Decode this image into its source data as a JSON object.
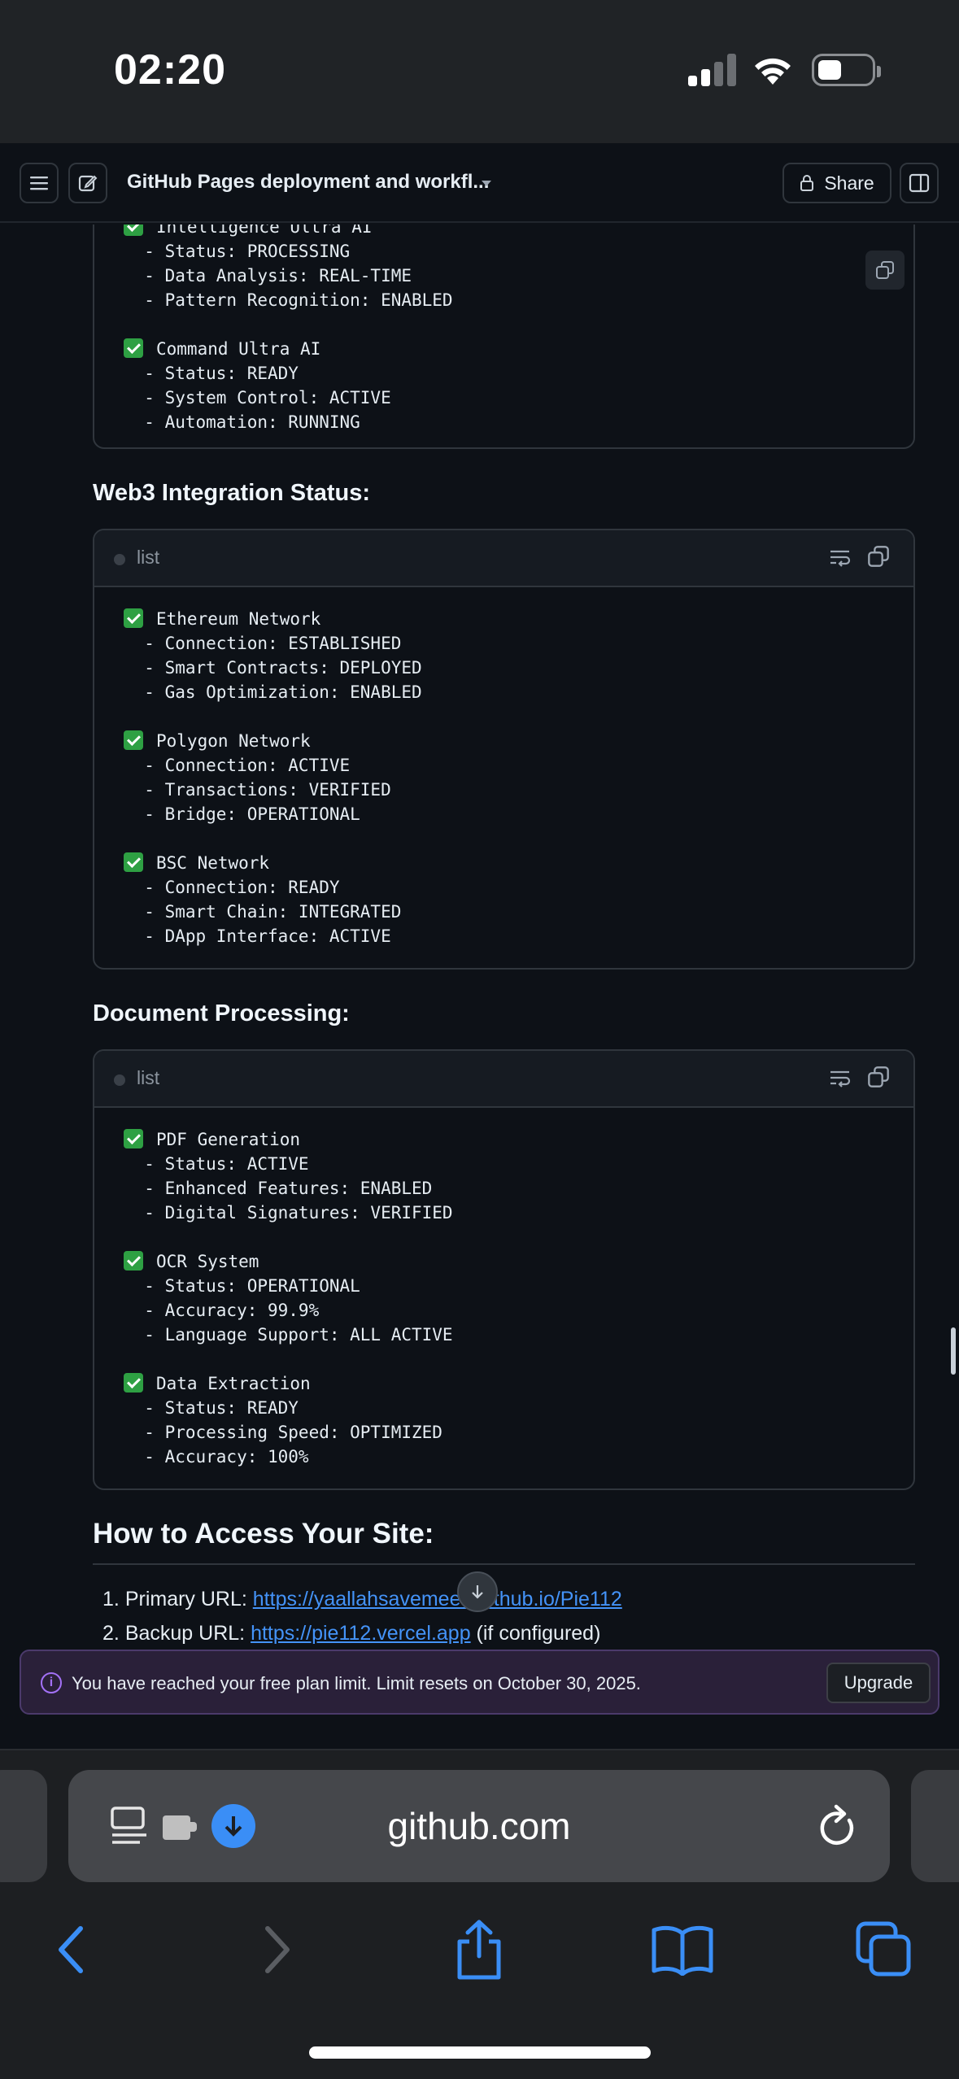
{
  "status_bar": {
    "time": "02:20"
  },
  "header": {
    "title": "GitHub Pages deployment and workfl...",
    "share_label": "Share"
  },
  "blocks": [
    {
      "lang": "",
      "lines": [
        {
          "check": true,
          "text": "Intelligence Ultra AI"
        },
        {
          "check": false,
          "text": "  - Status: PROCESSING"
        },
        {
          "check": false,
          "text": "  - Data Analysis: REAL-TIME"
        },
        {
          "check": false,
          "text": "  - Pattern Recognition: ENABLED"
        },
        {
          "check": false,
          "text": ""
        },
        {
          "check": true,
          "text": "Command Ultra AI"
        },
        {
          "check": false,
          "text": "  - Status: READY"
        },
        {
          "check": false,
          "text": "  - System Control: ACTIVE"
        },
        {
          "check": false,
          "text": "  - Automation: RUNNING"
        }
      ]
    },
    {
      "heading": "Web3 Integration Status:",
      "lang": "list",
      "lines": [
        {
          "check": true,
          "text": "Ethereum Network"
        },
        {
          "check": false,
          "text": "  - Connection: ESTABLISHED"
        },
        {
          "check": false,
          "text": "  - Smart Contracts: DEPLOYED"
        },
        {
          "check": false,
          "text": "  - Gas Optimization: ENABLED"
        },
        {
          "check": false,
          "text": ""
        },
        {
          "check": true,
          "text": "Polygon Network"
        },
        {
          "check": false,
          "text": "  - Connection: ACTIVE"
        },
        {
          "check": false,
          "text": "  - Transactions: VERIFIED"
        },
        {
          "check": false,
          "text": "  - Bridge: OPERATIONAL"
        },
        {
          "check": false,
          "text": ""
        },
        {
          "check": true,
          "text": "BSC Network"
        },
        {
          "check": false,
          "text": "  - Connection: READY"
        },
        {
          "check": false,
          "text": "  - Smart Chain: INTEGRATED"
        },
        {
          "check": false,
          "text": "  - DApp Interface: ACTIVE"
        }
      ]
    },
    {
      "heading": "Document Processing:",
      "lang": "list",
      "lines": [
        {
          "check": true,
          "text": "PDF Generation"
        },
        {
          "check": false,
          "text": "  - Status: ACTIVE"
        },
        {
          "check": false,
          "text": "  - Enhanced Features: ENABLED"
        },
        {
          "check": false,
          "text": "  - Digital Signatures: VERIFIED"
        },
        {
          "check": false,
          "text": ""
        },
        {
          "check": true,
          "text": "OCR System"
        },
        {
          "check": false,
          "text": "  - Status: OPERATIONAL"
        },
        {
          "check": false,
          "text": "  - Accuracy: 99.9%"
        },
        {
          "check": false,
          "text": "  - Language Support: ALL ACTIVE"
        },
        {
          "check": false,
          "text": ""
        },
        {
          "check": true,
          "text": "Data Extraction"
        },
        {
          "check": false,
          "text": "  - Status: READY"
        },
        {
          "check": false,
          "text": "  - Processing Speed: OPTIMIZED"
        },
        {
          "check": false,
          "text": "  - Accuracy: 100%"
        }
      ]
    }
  ],
  "access": {
    "heading": "How to Access Your Site:",
    "items": [
      {
        "num": "1.",
        "label": "Primary URL: ",
        "link": "https://yaallahsavemeee.github.io/Pie112",
        "suffix": ""
      },
      {
        "num": "2.",
        "label": "Backup URL: ",
        "link": "https://pie112.vercel.app",
        "suffix": " (if configured)"
      }
    ]
  },
  "banner": {
    "message": "You have reached your free plan limit. Limit resets on October 30, 2025.",
    "upgrade_label": "Upgrade"
  },
  "browser": {
    "url": "github.com"
  }
}
